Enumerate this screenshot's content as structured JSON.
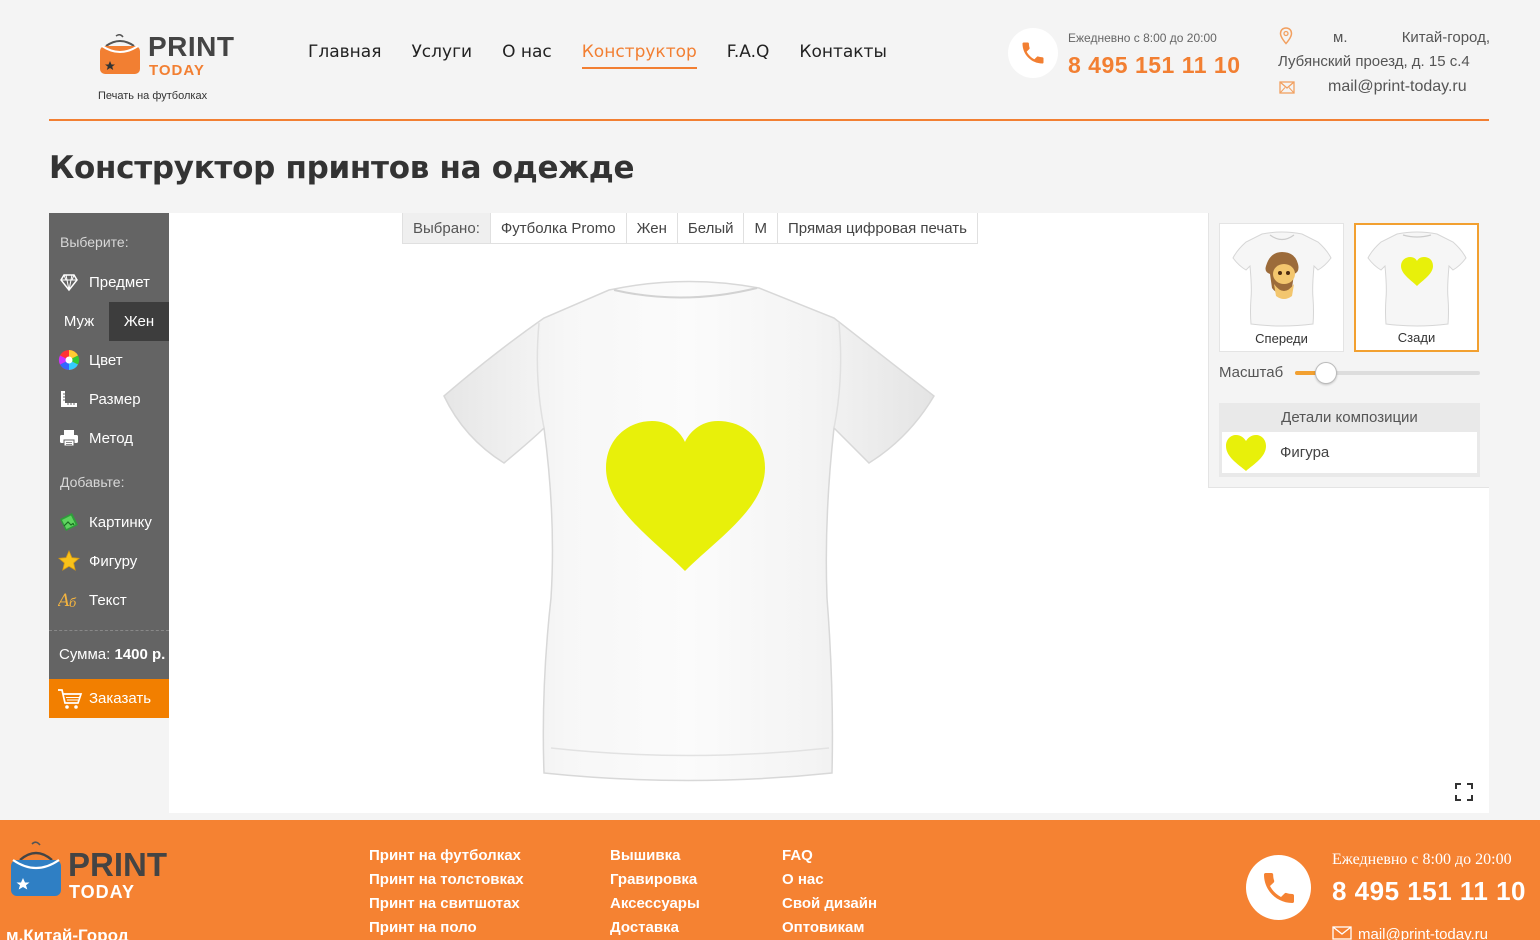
{
  "brand": {
    "name_line1": "PRINT",
    "name_line2": "TODAY",
    "tagline": "Печать на футболках",
    "accent": "#f27f32"
  },
  "nav": [
    {
      "label": "Главная",
      "active": false
    },
    {
      "label": "Услуги",
      "active": false
    },
    {
      "label": "О нас",
      "active": false
    },
    {
      "label": "Конструктор",
      "active": true
    },
    {
      "label": "F.A.Q",
      "active": false
    },
    {
      "label": "Контакты",
      "active": false
    }
  ],
  "contact": {
    "hours": "Ежедневно с 8:00 до 20:00",
    "phone": "8 495 151 11 10",
    "address_line1": "м. Китай-город,",
    "address_line2": "Лубянский проезд, д. 15 с.4",
    "email": "mail@print-today.ru"
  },
  "page_title": "Конструктор принтов на одежде",
  "sidebar": {
    "choose_label": "Выберите:",
    "item_subject": "Предмет",
    "gender_male": "Муж",
    "gender_female": "Жен",
    "item_color": "Цвет",
    "item_size": "Размер",
    "item_method": "Метод",
    "add_label": "Добавьте:",
    "item_image": "Картинку",
    "item_shape": "Фигуру",
    "item_text": "Текст",
    "sum_label": "Сумма:",
    "sum_value": "1400 р.",
    "order_label": "Заказать"
  },
  "selected": {
    "label": "Выбрано:",
    "values": [
      "Футболка Promo",
      "Жен",
      "Белый",
      "M",
      "Прямая цифровая печать"
    ]
  },
  "print_color": "#e8f00a",
  "views": {
    "front": "Спереди",
    "back": "Сзади",
    "active": "back"
  },
  "scale": {
    "label": "Масштаб",
    "value_fraction": 0.17
  },
  "details": {
    "title": "Детали композиции",
    "items": [
      {
        "name": "Фигура"
      }
    ]
  },
  "footer": {
    "address": "м.Китай-Город",
    "col1": [
      "Принт на футболках",
      "Принт на толстовках",
      "Принт на свитшотах",
      "Принт на поло"
    ],
    "col2": [
      "Вышивка",
      "Гравировка",
      "Аксессуары",
      "Доставка"
    ],
    "col3": [
      "FAQ",
      "О нас",
      "Свой дизайн",
      "Оптовикам"
    ],
    "hours": "Ежедневно с 8:00 до 20:00",
    "phone": "8 495 151 11 10",
    "email": "mail@print-today.ru"
  }
}
